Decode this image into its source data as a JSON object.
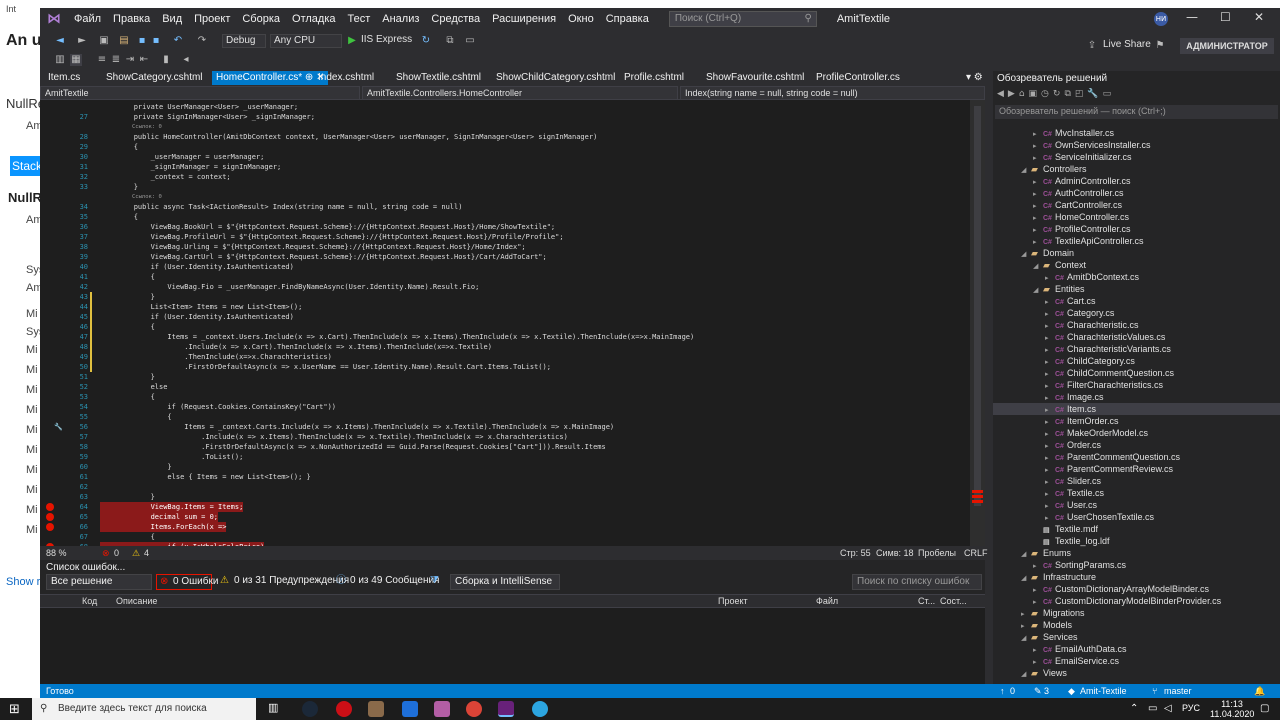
{
  "browser": {
    "tab_label": "Int",
    "heading": "An u",
    "subtitle": "NullRe",
    "aside_lines": [
      "Am",
      "Stack",
      "NullR",
      "Am",
      "Sys",
      "Am",
      "Mi",
      "Sys",
      "Mi",
      "Mi",
      "Mi",
      "Mi",
      "Mi",
      "Mi",
      "Mi",
      "Mi",
      "Mi",
      "Mi"
    ],
    "show_more": "Show r"
  },
  "titlebar": {
    "menu": [
      "Файл",
      "Правка",
      "Вид",
      "Проект",
      "Сборка",
      "Отладка",
      "Тест",
      "Анализ",
      "Средства",
      "Расширения",
      "Окно",
      "Справка"
    ],
    "search_placeholder": "Поиск (Ctrl+Q)",
    "solution_name": "AmitTextile",
    "avatar": "НИ"
  },
  "toolbar": {
    "config": "Debug",
    "platform": "Any CPU",
    "run_target": "IIS Express",
    "live_share": "Live Share",
    "admin": "АДМИНИСТРАТОР"
  },
  "tabs": [
    "Item.cs",
    "ShowCategory.cshtml",
    "HomeController.cs*",
    "Index.cshtml",
    "ShowTextile.cshtml",
    "ShowChildCategory.cshtml",
    "Profile.cshtml",
    "ShowFavourite.cshtml",
    "ProfileController.cs"
  ],
  "navbar": {
    "project": "AmitTextile",
    "class": "AmitTextile.Controllers.HomeController",
    "member": "Index(string name = null, string code = null)"
  },
  "code_lines": [
    {
      "n": "",
      "t": "        private UserManager<User> _userManager;"
    },
    {
      "n": "27",
      "t": "        private SignInManager<User> _signInManager;"
    },
    {
      "n": "",
      "ref": "Ссылок: 0"
    },
    {
      "n": "28",
      "t": "        public HomeController(AmitDbContext context, UserManager<User> userManager, SignInManager<User> signInManager)"
    },
    {
      "n": "29",
      "t": "        {"
    },
    {
      "n": "30",
      "t": "            _userManager = userManager;"
    },
    {
      "n": "31",
      "t": "            _signInManager = signInManager;"
    },
    {
      "n": "32",
      "t": "            _context = context;"
    },
    {
      "n": "33",
      "t": "        }"
    },
    {
      "n": "",
      "ref": "Ссылок: 0"
    },
    {
      "n": "34",
      "t": "        public async Task<IActionResult> Index(string name = null, string code = null)"
    },
    {
      "n": "35",
      "t": "        {"
    },
    {
      "n": "36",
      "t": "            ViewBag.BookUrl = $\"{HttpContext.Request.Scheme}://{HttpContext.Request.Host}/Home/ShowTextile\";"
    },
    {
      "n": "37",
      "t": "            ViewBag.ProfileUrl = $\"{HttpContext.Request.Scheme}://{HttpContext.Request.Host}/Profile/Profile\";"
    },
    {
      "n": "38",
      "t": "            ViewBag.Urling = $\"{HttpContext.Request.Scheme}://{HttpContext.Request.Host}/Home/Index\";"
    },
    {
      "n": "39",
      "t": "            ViewBag.CartUrl = $\"{HttpContext.Request.Scheme}://{HttpContext.Request.Host}/Cart/AddToCart\";"
    },
    {
      "n": "40",
      "t": "            if (User.Identity.IsAuthenticated)"
    },
    {
      "n": "41",
      "t": "            {"
    },
    {
      "n": "42",
      "t": "                ViewBag.Fio = _userManager.FindByNameAsync(User.Identity.Name).Result.Fio;"
    },
    {
      "n": "43",
      "t": "            }"
    },
    {
      "n": "44",
      "t": "            List<Item> Items = new List<Item>();"
    },
    {
      "n": "45",
      "t": "            if (User.Identity.IsAuthenticated)"
    },
    {
      "n": "46",
      "t": "            {"
    },
    {
      "n": "47",
      "t": "                Items = _context.Users.Include(x => x.Cart).ThenInclude(x => x.Items).ThenInclude(x => x.Textile).ThenInclude(x=>x.MainImage)"
    },
    {
      "n": "48",
      "t": "                    .Include(x => x.Cart).ThenInclude(x => x.Items).ThenInclude(x=>x.Textile)"
    },
    {
      "n": "49",
      "t": "                    .ThenInclude(x=>x.Charachteristics)"
    },
    {
      "n": "50",
      "t": "                    .FirstOrDefaultAsync(x => x.UserName == User.Identity.Name).Result.Cart.Items.ToList();"
    },
    {
      "n": "51",
      "t": "            }"
    },
    {
      "n": "52",
      "t": "            else"
    },
    {
      "n": "53",
      "t": "            {"
    },
    {
      "n": "54",
      "t": "                if (Request.Cookies.ContainsKey(\"Cart\"))"
    },
    {
      "n": "55",
      "t": "                {"
    },
    {
      "n": "56",
      "t": "                    Items = _context.Carts.Include(x => x.Items).ThenInclude(x => x.Textile).ThenInclude(x => x.MainImage)"
    },
    {
      "n": "57",
      "t": "                        .Include(x => x.Items).ThenInclude(x => x.Textile).ThenInclude(x => x.Charachteristics)"
    },
    {
      "n": "58",
      "t": "                        .FirstOrDefaultAsync(x => x.NonAuthorizedId == Guid.Parse(Request.Cookies[\"Cart\"])).Result.Items"
    },
    {
      "n": "59",
      "t": "                        .ToList();"
    },
    {
      "n": "60",
      "t": "                }"
    },
    {
      "n": "61",
      "t": "                else { Items = new List<Item>(); }"
    },
    {
      "n": "62",
      "t": ""
    },
    {
      "n": "63",
      "t": "            }"
    },
    {
      "n": "64",
      "t": "            ViewBag.Items = Items;",
      "bp": true
    },
    {
      "n": "65",
      "t": "            decimal sum = 0;",
      "bp": true
    },
    {
      "n": "66",
      "t": "            Items.ForEach(x =>",
      "bp": true
    },
    {
      "n": "67",
      "t": "            {",
      "bp": false
    },
    {
      "n": "68",
      "t": "                if (x.IsWholeSalePrice)",
      "bp": true
    }
  ],
  "editor_status": {
    "zoom": "88 %",
    "errors": "0",
    "warnings": "4",
    "line": "Стр: 55",
    "col": "Симв: 18",
    "spaces": "Пробелы",
    "eol": "CRLF"
  },
  "error_list": {
    "title": "Список ошибок...",
    "scope": "Все решение",
    "errors": "0 Ошибки",
    "warnings": "0 из 31 Предупреждения",
    "messages": "0 из 49 Сообщения",
    "build": "Сборка и IntelliSense",
    "search_placeholder": "Поиск по списку ошибок",
    "columns": [
      "Код",
      "Описание",
      "Проект",
      "Файл",
      "Ст...",
      "Сост..."
    ]
  },
  "solution_explorer": {
    "title": "Обозреватель решений",
    "search_placeholder": "Обозреватель решений — поиск (Ctrl+;)",
    "nodes": [
      {
        "label": "MvcInstaller.cs",
        "depth": 3,
        "type": "cs",
        "arrow": "▸"
      },
      {
        "label": "OwnServicesInstaller.cs",
        "depth": 3,
        "type": "cs",
        "arrow": "▸"
      },
      {
        "label": "ServiceInitializer.cs",
        "depth": 3,
        "type": "cs",
        "arrow": "▸"
      },
      {
        "label": "Controllers",
        "depth": 2,
        "type": "folder",
        "arrow": "◢"
      },
      {
        "label": "AdminController.cs",
        "depth": 3,
        "type": "cs",
        "arrow": "▸"
      },
      {
        "label": "AuthController.cs",
        "depth": 3,
        "type": "cs",
        "arrow": "▸"
      },
      {
        "label": "CartController.cs",
        "depth": 3,
        "type": "cs",
        "arrow": "▸"
      },
      {
        "label": "HomeController.cs",
        "depth": 3,
        "type": "cs",
        "arrow": "▸"
      },
      {
        "label": "ProfileController.cs",
        "depth": 3,
        "type": "cs",
        "arrow": "▸"
      },
      {
        "label": "TextileApiController.cs",
        "depth": 3,
        "type": "cs",
        "arrow": "▸"
      },
      {
        "label": "Domain",
        "depth": 2,
        "type": "folder",
        "arrow": "◢"
      },
      {
        "label": "Context",
        "depth": 3,
        "type": "folder",
        "arrow": "◢"
      },
      {
        "label": "AmitDbContext.cs",
        "depth": 4,
        "type": "cs",
        "arrow": "▸"
      },
      {
        "label": "Entities",
        "depth": 3,
        "type": "folder",
        "arrow": "◢"
      },
      {
        "label": "Cart.cs",
        "depth": 4,
        "type": "cs",
        "arrow": "▸"
      },
      {
        "label": "Category.cs",
        "depth": 4,
        "type": "cs",
        "arrow": "▸"
      },
      {
        "label": "Charachteristic.cs",
        "depth": 4,
        "type": "cs",
        "arrow": "▸"
      },
      {
        "label": "CharachteristicValues.cs",
        "depth": 4,
        "type": "cs",
        "arrow": "▸"
      },
      {
        "label": "CharachteristicVariants.cs",
        "depth": 4,
        "type": "cs",
        "arrow": "▸"
      },
      {
        "label": "ChildCategory.cs",
        "depth": 4,
        "type": "cs",
        "arrow": "▸"
      },
      {
        "label": "ChildCommentQuestion.cs",
        "depth": 4,
        "type": "cs",
        "arrow": "▸"
      },
      {
        "label": "FilterCharachteristics.cs",
        "depth": 4,
        "type": "cs",
        "arrow": "▸"
      },
      {
        "label": "Image.cs",
        "depth": 4,
        "type": "cs",
        "arrow": "▸"
      },
      {
        "label": "Item.cs",
        "depth": 4,
        "type": "cs",
        "arrow": "▸",
        "selected": true
      },
      {
        "label": "ItemOrder.cs",
        "depth": 4,
        "type": "cs",
        "arrow": "▸"
      },
      {
        "label": "MakeOrderModel.cs",
        "depth": 4,
        "type": "cs",
        "arrow": "▸"
      },
      {
        "label": "Order.cs",
        "depth": 4,
        "type": "cs",
        "arrow": "▸"
      },
      {
        "label": "ParentCommentQuestion.cs",
        "depth": 4,
        "type": "cs",
        "arrow": "▸"
      },
      {
        "label": "ParentCommentReview.cs",
        "depth": 4,
        "type": "cs",
        "arrow": "▸"
      },
      {
        "label": "Slider.cs",
        "depth": 4,
        "type": "cs",
        "arrow": "▸"
      },
      {
        "label": "Textile.cs",
        "depth": 4,
        "type": "cs",
        "arrow": "▸"
      },
      {
        "label": "User.cs",
        "depth": 4,
        "type": "cs",
        "arrow": "▸"
      },
      {
        "label": "UserChosenTextile.cs",
        "depth": 4,
        "type": "cs",
        "arrow": "▸"
      },
      {
        "label": "Textile.mdf",
        "depth": 3,
        "type": "file",
        "arrow": ""
      },
      {
        "label": "Textile_log.ldf",
        "depth": 3,
        "type": "file",
        "arrow": ""
      },
      {
        "label": "Enums",
        "depth": 2,
        "type": "folder",
        "arrow": "◢"
      },
      {
        "label": "SortingParams.cs",
        "depth": 3,
        "type": "cs",
        "arrow": "▸"
      },
      {
        "label": "Infrastructure",
        "depth": 2,
        "type": "folder",
        "arrow": "◢"
      },
      {
        "label": "CustomDictionaryArrayModelBinder.cs",
        "depth": 3,
        "type": "cs",
        "arrow": "▸"
      },
      {
        "label": "CustomDictionaryModelBinderProvider.cs",
        "depth": 3,
        "type": "cs",
        "arrow": "▸"
      },
      {
        "label": "Migrations",
        "depth": 2,
        "type": "folder",
        "arrow": "▸"
      },
      {
        "label": "Models",
        "depth": 2,
        "type": "folder",
        "arrow": "▸"
      },
      {
        "label": "Services",
        "depth": 2,
        "type": "folder",
        "arrow": "◢"
      },
      {
        "label": "EmailAuthData.cs",
        "depth": 3,
        "type": "cs",
        "arrow": "▸"
      },
      {
        "label": "EmailService.cs",
        "depth": 3,
        "type": "cs",
        "arrow": "▸"
      },
      {
        "label": "Views",
        "depth": 2,
        "type": "folder",
        "arrow": "◢"
      }
    ]
  },
  "statusbar": {
    "ready": "Готово",
    "up": "0",
    "pencil": "3",
    "project": "Amit-Textile",
    "branch": "master"
  },
  "taskbar": {
    "search_placeholder": "Введите здесь текст для поиска",
    "lang": "РУС",
    "time": "11:13",
    "date": "11.04.2020"
  }
}
